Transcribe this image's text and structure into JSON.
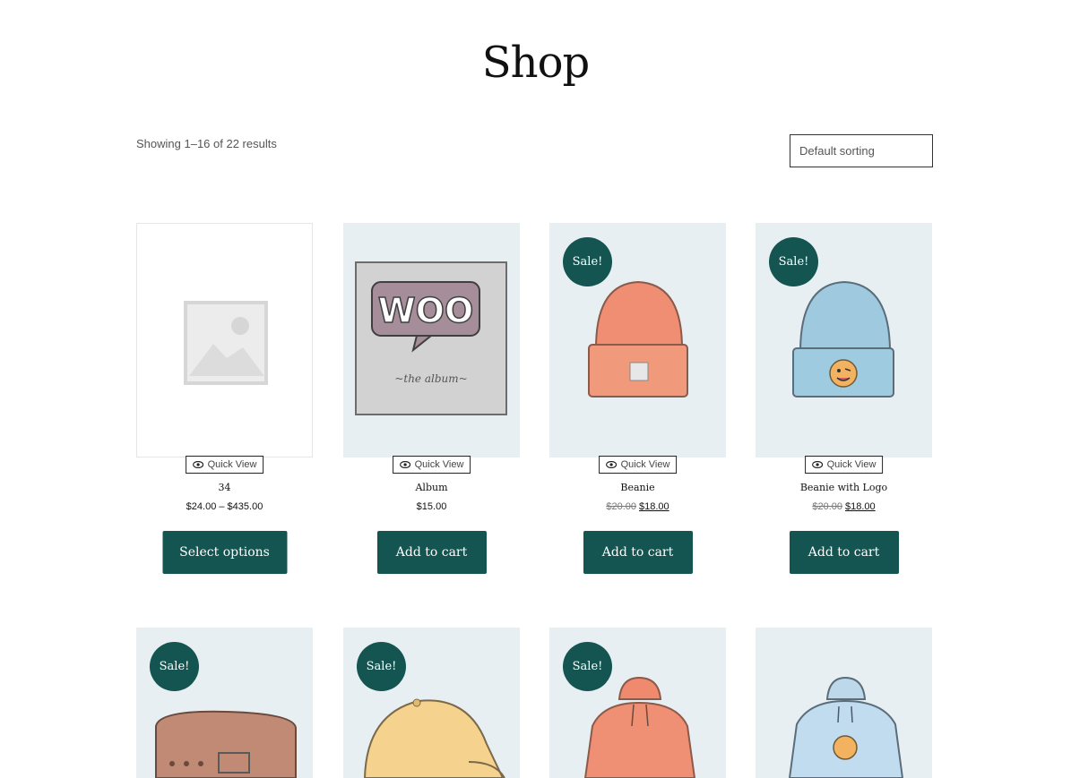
{
  "page": {
    "title": "Shop",
    "result_count": "Showing 1–16 of 22 results",
    "sorting": "Default sorting"
  },
  "colors": {
    "accent": "#145451",
    "image_bg": "#e8eff3"
  },
  "quick_view_label": "Quick View",
  "sale_label": "Sale!",
  "products": [
    {
      "name": "34",
      "price": "$24.00 – $435.00",
      "button": "Select options",
      "image": "placeholder-image-icon"
    },
    {
      "name": "Album",
      "price": "$15.00",
      "button": "Add to cart",
      "image": "album-woo-image"
    },
    {
      "name": "Beanie",
      "old_price": "$20.00",
      "price": "$18.00",
      "button": "Add to cart",
      "sale": true,
      "image": "orange-beanie-image"
    },
    {
      "name": "Beanie with Logo",
      "old_price": "$20.00",
      "price": "$18.00",
      "button": "Add to cart",
      "sale": true,
      "image": "blue-beanie-image"
    },
    {
      "sale": true,
      "image": "belt-image"
    },
    {
      "sale": true,
      "image": "cap-image"
    },
    {
      "sale": true,
      "image": "orange-hoodie-image"
    },
    {
      "image": "blue-hoodie-logo-image"
    }
  ]
}
